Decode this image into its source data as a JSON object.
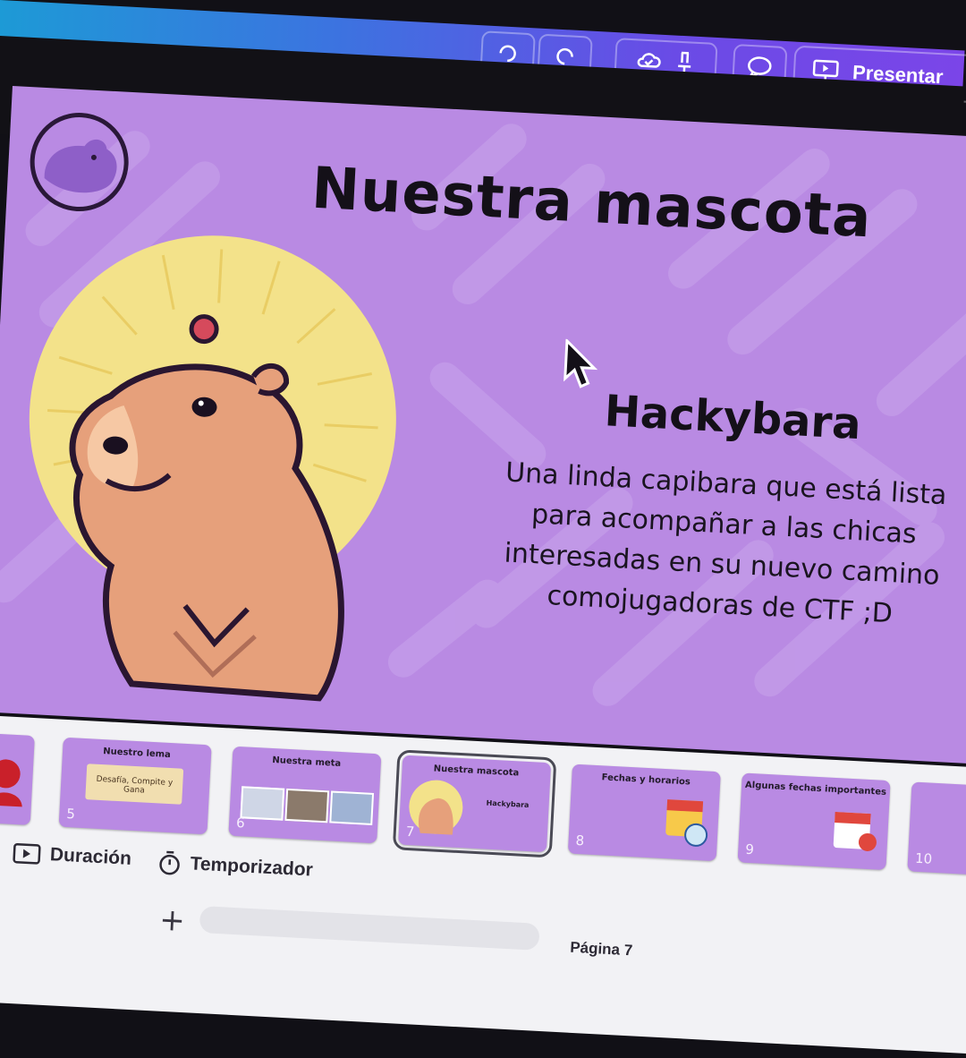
{
  "toolbar": {
    "present_label": "Presentar",
    "icons": [
      "undo-icon",
      "redo-icon",
      "cloud-save-icon",
      "pin-icon",
      "comment-icon",
      "present-icon"
    ]
  },
  "slide": {
    "title": "Nuestra mascota",
    "mascot_name": "Hackybara",
    "description": "Una linda capibara que está lista para acompañar a las chicas interesadas en su nuevo camino comojugadoras de CTF ;D",
    "colors": {
      "background": "#b98ae3",
      "text": "#141018",
      "halo": "#f3e28a",
      "capybara": "#e6a07b"
    }
  },
  "thumbnails": [
    {
      "number": "",
      "title": ""
    },
    {
      "number": "5",
      "title": "Nuestro lema",
      "body": "Desafía, Compite y Gana"
    },
    {
      "number": "6",
      "title": "Nuestra meta",
      "body": ""
    },
    {
      "number": "7",
      "title": "Nuestra mascota",
      "body": "Hackybara"
    },
    {
      "number": "8",
      "title": "Fechas y horarios",
      "body": ""
    },
    {
      "number": "9",
      "title": "Algunas fechas importantes",
      "body": ""
    },
    {
      "number": "10",
      "title": "",
      "body": ""
    }
  ],
  "bottom_bar": {
    "duration_label": "Duración",
    "timer_label": "Temporizador",
    "page_label": "Página 7"
  }
}
